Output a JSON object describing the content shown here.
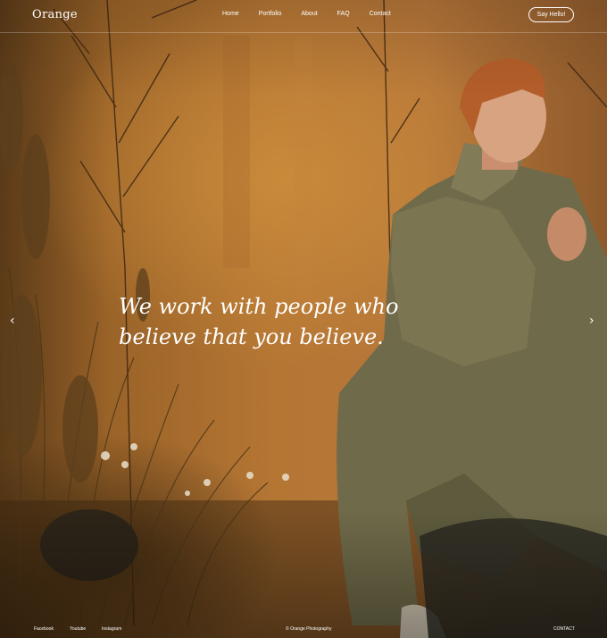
{
  "header": {
    "logo": "Orange",
    "nav": [
      "Home",
      "Portfolio",
      "About",
      "FAQ",
      "Contact"
    ],
    "cta": "Say Hello!"
  },
  "hero": {
    "headline_line1": "We work with people who",
    "headline_line2": "believe that you believe.",
    "prev_icon": "chevron-left-icon",
    "next_icon": "chevron-right-icon"
  },
  "footer": {
    "social": [
      "Facebook",
      "Youtube",
      "Instagram"
    ],
    "copyright": "© Orange Photography",
    "contact": "CONTACT"
  },
  "colors": {
    "background": "#b57634",
    "text": "#ffffff"
  }
}
